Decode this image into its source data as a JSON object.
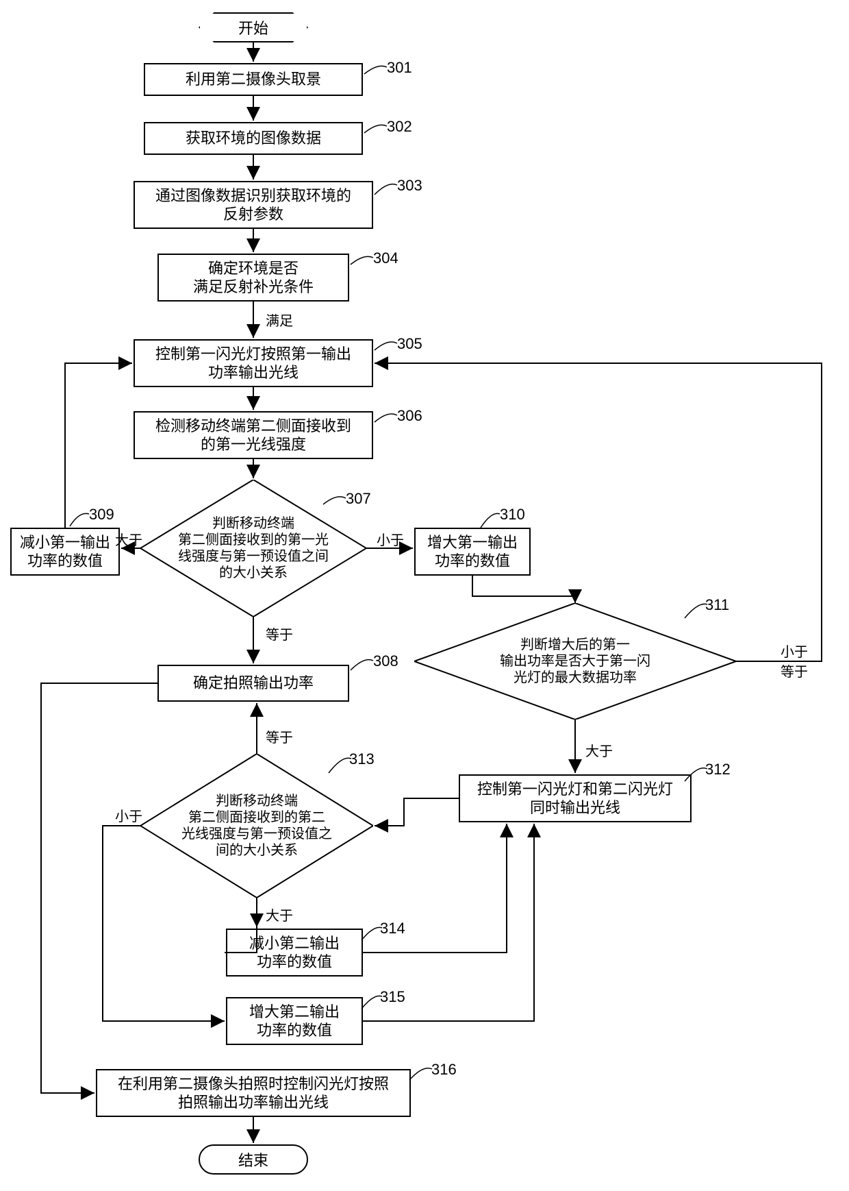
{
  "terminator": {
    "start": "开始",
    "end": "结束"
  },
  "steps": {
    "s301": "利用第二摄像头取景",
    "s302": "获取环境的图像数据",
    "s303": "通过图像数据识别获取环境的\n反射参数",
    "s304": "确定环境是否\n满足反射补光条件",
    "s305": "控制第一闪光灯按照第一输出\n功率输出光线",
    "s306": "检测移动终端第二侧面接收到\n的第一光线强度",
    "s307": "判断移动终端\n第二侧面接收到的第一光\n线强度与第一预设值之间\n的大小关系",
    "s308": "确定拍照输出功率",
    "s309": "减小第一输出\n功率的数值",
    "s310": "增大第一输出\n功率的数值",
    "s311": "判断增大后的第一\n输出功率是否大于第一闪\n光灯的最大数据功率",
    "s312": "控制第一闪光灯和第二闪光灯\n同时输出光线",
    "s313": "判断移动终端\n第二侧面接收到的第二\n光线强度与第一预设值之\n间的大小关系",
    "s314": "减小第二输出\n功率的数值",
    "s315": "增大第二输出\n功率的数值",
    "s316": "在利用第二摄像头拍照时控制闪光灯按照\n拍照输出功率输出光线"
  },
  "labels": {
    "n301": "301",
    "n302": "302",
    "n303": "303",
    "n304": "304",
    "n305": "305",
    "n306": "306",
    "n307": "307",
    "n308": "308",
    "n309": "309",
    "n310": "310",
    "n311": "311",
    "n312": "312",
    "n313": "313",
    "n314": "314",
    "n315": "315",
    "n316": "316"
  },
  "edges": {
    "satisfy": "满足",
    "gt": "大于",
    "lt": "小于",
    "eq": "等于",
    "lte": "小于\n等于"
  },
  "chart_data": {
    "type": "flowchart",
    "nodes": [
      {
        "id": "start",
        "type": "terminator",
        "label": "开始"
      },
      {
        "id": "301",
        "type": "process",
        "label": "利用第二摄像头取景"
      },
      {
        "id": "302",
        "type": "process",
        "label": "获取环境的图像数据"
      },
      {
        "id": "303",
        "type": "process",
        "label": "通过图像数据识别获取环境的反射参数"
      },
      {
        "id": "304",
        "type": "process",
        "label": "确定环境是否满足反射补光条件"
      },
      {
        "id": "305",
        "type": "process",
        "label": "控制第一闪光灯按照第一输出功率输出光线"
      },
      {
        "id": "306",
        "type": "process",
        "label": "检测移动终端第二侧面接收到的第一光线强度"
      },
      {
        "id": "307",
        "type": "decision",
        "label": "判断移动终端第二侧面接收到的第一光线强度与第一预设值之间的大小关系"
      },
      {
        "id": "308",
        "type": "process",
        "label": "确定拍照输出功率"
      },
      {
        "id": "309",
        "type": "process",
        "label": "减小第一输出功率的数值"
      },
      {
        "id": "310",
        "type": "process",
        "label": "增大第一输出功率的数值"
      },
      {
        "id": "311",
        "type": "decision",
        "label": "判断增大后的第一输出功率是否大于第一闪光灯的最大数据功率"
      },
      {
        "id": "312",
        "type": "process",
        "label": "控制第一闪光灯和第二闪光灯同时输出光线"
      },
      {
        "id": "313",
        "type": "decision",
        "label": "判断移动终端第二侧面接收到的第二光线强度与第一预设值之间的大小关系"
      },
      {
        "id": "314",
        "type": "process",
        "label": "减小第二输出功率的数值"
      },
      {
        "id": "315",
        "type": "process",
        "label": "增大第二输出功率的数值"
      },
      {
        "id": "316",
        "type": "process",
        "label": "在利用第二摄像头拍照时控制闪光灯按照拍照输出功率输出光线"
      },
      {
        "id": "end",
        "type": "terminator",
        "label": "结束"
      }
    ],
    "edges": [
      {
        "from": "start",
        "to": "301"
      },
      {
        "from": "301",
        "to": "302"
      },
      {
        "from": "302",
        "to": "303"
      },
      {
        "from": "303",
        "to": "304"
      },
      {
        "from": "304",
        "to": "305",
        "label": "满足"
      },
      {
        "from": "305",
        "to": "306"
      },
      {
        "from": "306",
        "to": "307"
      },
      {
        "from": "307",
        "to": "309",
        "label": "大于"
      },
      {
        "from": "307",
        "to": "310",
        "label": "小于"
      },
      {
        "from": "307",
        "to": "308",
        "label": "等于"
      },
      {
        "from": "309",
        "to": "305"
      },
      {
        "from": "310",
        "to": "311"
      },
      {
        "from": "311",
        "to": "305",
        "label": "小于等于"
      },
      {
        "from": "311",
        "to": "312",
        "label": "大于"
      },
      {
        "from": "312",
        "to": "313"
      },
      {
        "from": "313",
        "to": "308",
        "label": "等于"
      },
      {
        "from": "313",
        "to": "314",
        "label": "大于"
      },
      {
        "from": "313",
        "to": "315",
        "label": "小于"
      },
      {
        "from": "314",
        "to": "312"
      },
      {
        "from": "315",
        "to": "312"
      },
      {
        "from": "308",
        "to": "316"
      },
      {
        "from": "316",
        "to": "end"
      }
    ]
  }
}
